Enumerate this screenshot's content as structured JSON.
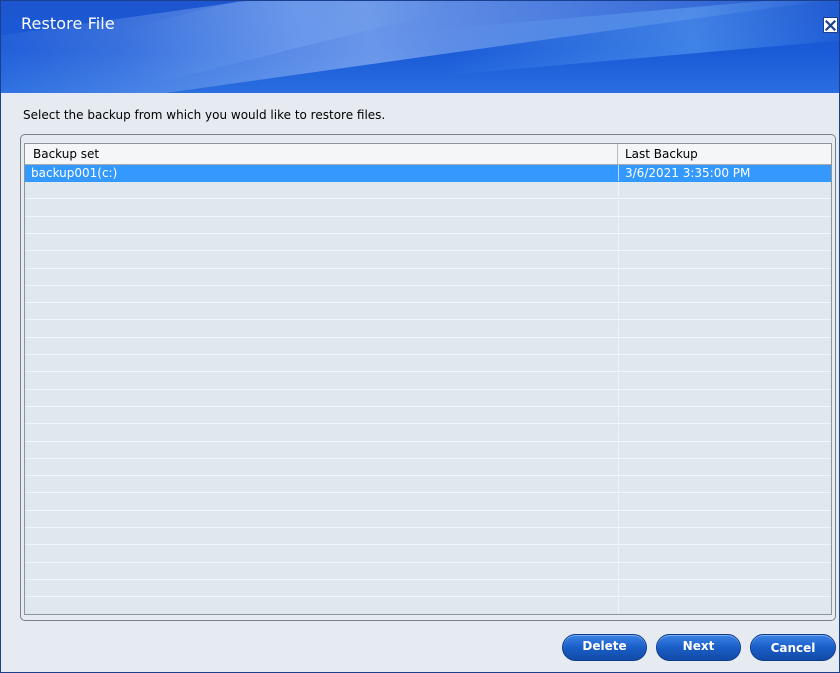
{
  "window": {
    "title": "Restore File",
    "close_icon": "close-icon"
  },
  "instruction": "Select the backup from which you would like to restore files.",
  "table": {
    "columns": [
      "Backup set",
      "Last Backup"
    ],
    "rows": [
      {
        "backup_set": "backup001(c:)",
        "last_backup": "3/6/2021 3:35:00 PM",
        "selected": true
      }
    ]
  },
  "buttons": {
    "delete": "Delete",
    "next": "Next",
    "cancel": "Cancel"
  },
  "colors": {
    "header_blue": "#1a5ad7",
    "selection": "#3399ff",
    "button_blue": "#1a5ec8"
  }
}
